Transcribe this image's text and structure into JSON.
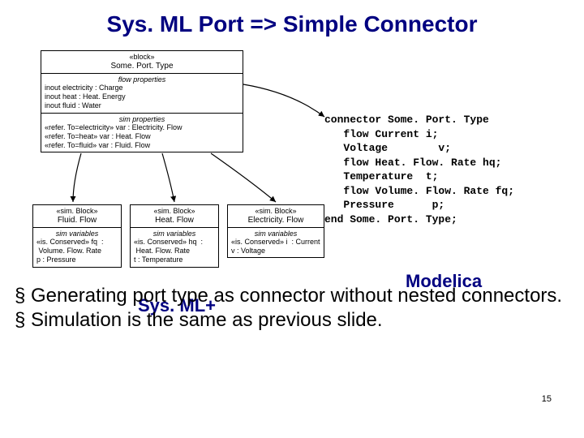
{
  "title": "Sys. ML Port => Simple Connector",
  "block": {
    "stereotype": "«block»",
    "name": "Some. Port. Type",
    "flow_title": "flow properties",
    "flow_props": "inout electricity : Charge\ninout heat : Heat. Energy\ninout fluid : Water",
    "sim_title": "sim properties",
    "sim_props": "«refer. To=electricity» var : Electricity. Flow\n«refer. To=heat» var : Heat. Flow\n«refer. To=fluid» var : Fluid. Flow"
  },
  "children": [
    {
      "stereotype": "«sim. Block»",
      "name": "Fluid. Flow",
      "vars_title": "sim variables",
      "vars": "«is. Conserved» fq  :\n Volume. Flow. Rate\np : Pressure"
    },
    {
      "stereotype": "«sim. Block»",
      "name": "Heat. Flow",
      "vars_title": "sim variables",
      "vars": "«is. Conserved» hq  :\n Heat. Flow. Rate\nt : Temperature"
    },
    {
      "stereotype": "«sim. Block»",
      "name": "Electricity. Flow",
      "vars_title": "sim variables",
      "vars": "«is. Conserved» i  : Current\nv : Voltage"
    }
  ],
  "code": "connector Some. Port. Type\n   flow Current i;\n   Voltage        v;\n   flow Heat. Flow. Rate hq;\n   Temperature  t;\n   flow Volume. Flow. Rate fq;\n   Pressure      p;\nend Some. Port. Type;",
  "modelica": "Modelica",
  "sysmlplus": "Sys. ML+",
  "bullets": [
    "Generating port type as connector without nested connectors.",
    "Simulation is the same as previous slide."
  ],
  "pagenum": "15"
}
